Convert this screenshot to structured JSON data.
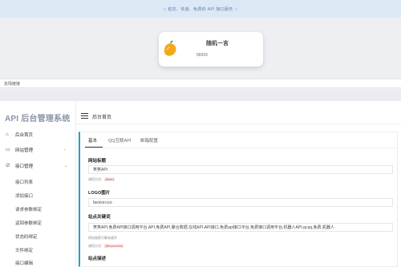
{
  "preview": {
    "slogan": "☆ 稳定、快速、免费的 API 接口服务 ☆",
    "card_title": "随机一言",
    "card_count": "88999",
    "friend_links": "友情链接"
  },
  "admin": {
    "brand": "API 后台管理系统",
    "breadcrumb": "后台首页",
    "nav": [
      {
        "label": "后台首页",
        "icon": "home-icon",
        "arrow": ""
      },
      {
        "label": "网站管理",
        "icon": "monitor-icon",
        "arrow": "›"
      },
      {
        "label": "接口管理",
        "icon": "link-icon",
        "arrow": "⌄"
      }
    ],
    "sub_items": [
      "接口列表",
      "添加接口",
      "请求参数绑定",
      "返回参数绑定",
      "状态码绑定",
      "文件绑定",
      "接口编辑"
    ],
    "tabs": [
      "基本",
      "QQ互联API",
      "邮箱配置"
    ],
    "fields": {
      "site_title_label": "网站标题",
      "site_title_value": "笑笑API",
      "site_title_hint_prefix": "调用方式：",
      "site_title_hint_code": "{$title}",
      "logo_label": "LOGO图片",
      "logo_value": "favicon.ico",
      "keywords_label": "站点关键词",
      "keywords_value": "笑笑API,免费API接口调用平台,API,免费API,聚合数据,在线API,API接口,免费api接口平台,免费接口调用平台,机器人API,qr,qq,免费,机器人",
      "keywords_hint1": "网站搜索引擎关键字",
      "keywords_hint2_prefix": "调用方式：",
      "keywords_hint2_code": "{$keywords}",
      "description_label": "站点描述"
    }
  },
  "colors": {
    "accent": "#2c9dc2",
    "topbar": "#dde8f5",
    "code_text": "#d64545"
  }
}
